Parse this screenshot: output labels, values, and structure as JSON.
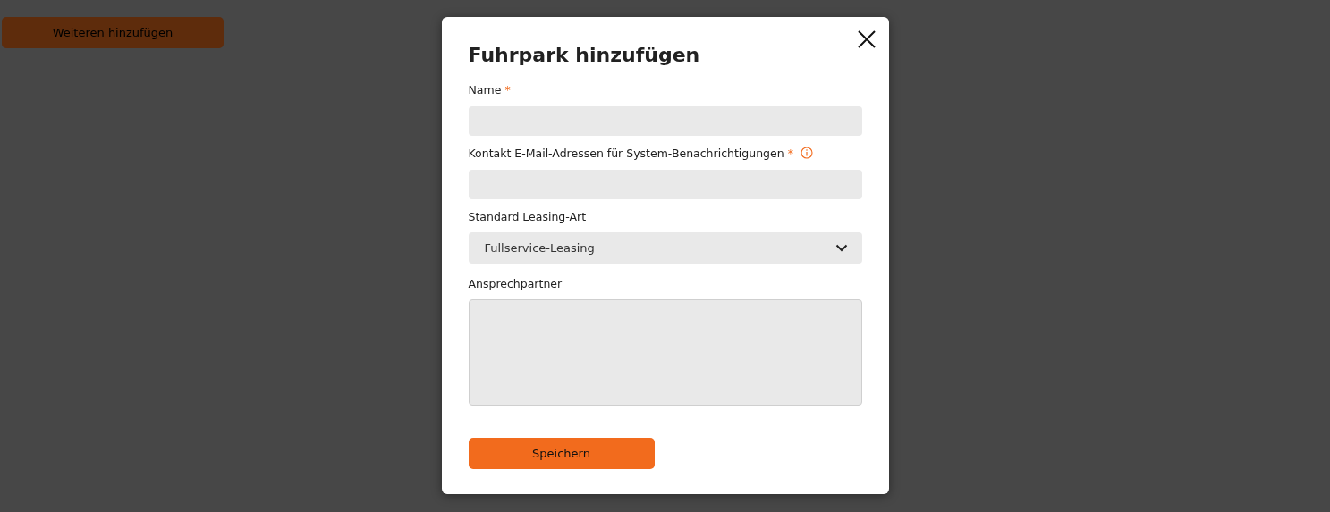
{
  "background": {
    "button": "Weiteren hinzufügen"
  },
  "dialog": {
    "title": "Fuhrpark hinzufügen",
    "fields": [
      {
        "kind": "text",
        "label": "Name",
        "required_mark": "*",
        "info": false
      },
      {
        "kind": "text",
        "label": "Kontakt E-Mail-Adressen für System-Benachrichtigungen",
        "required_mark": "*",
        "info": true
      },
      {
        "kind": "select",
        "label": "Standard Leasing-Art",
        "value": "Fullservice-Leasing",
        "info": false
      },
      {
        "kind": "textarea",
        "label": "Ansprechpartner",
        "info": false
      }
    ],
    "submit": "Speichern"
  }
}
